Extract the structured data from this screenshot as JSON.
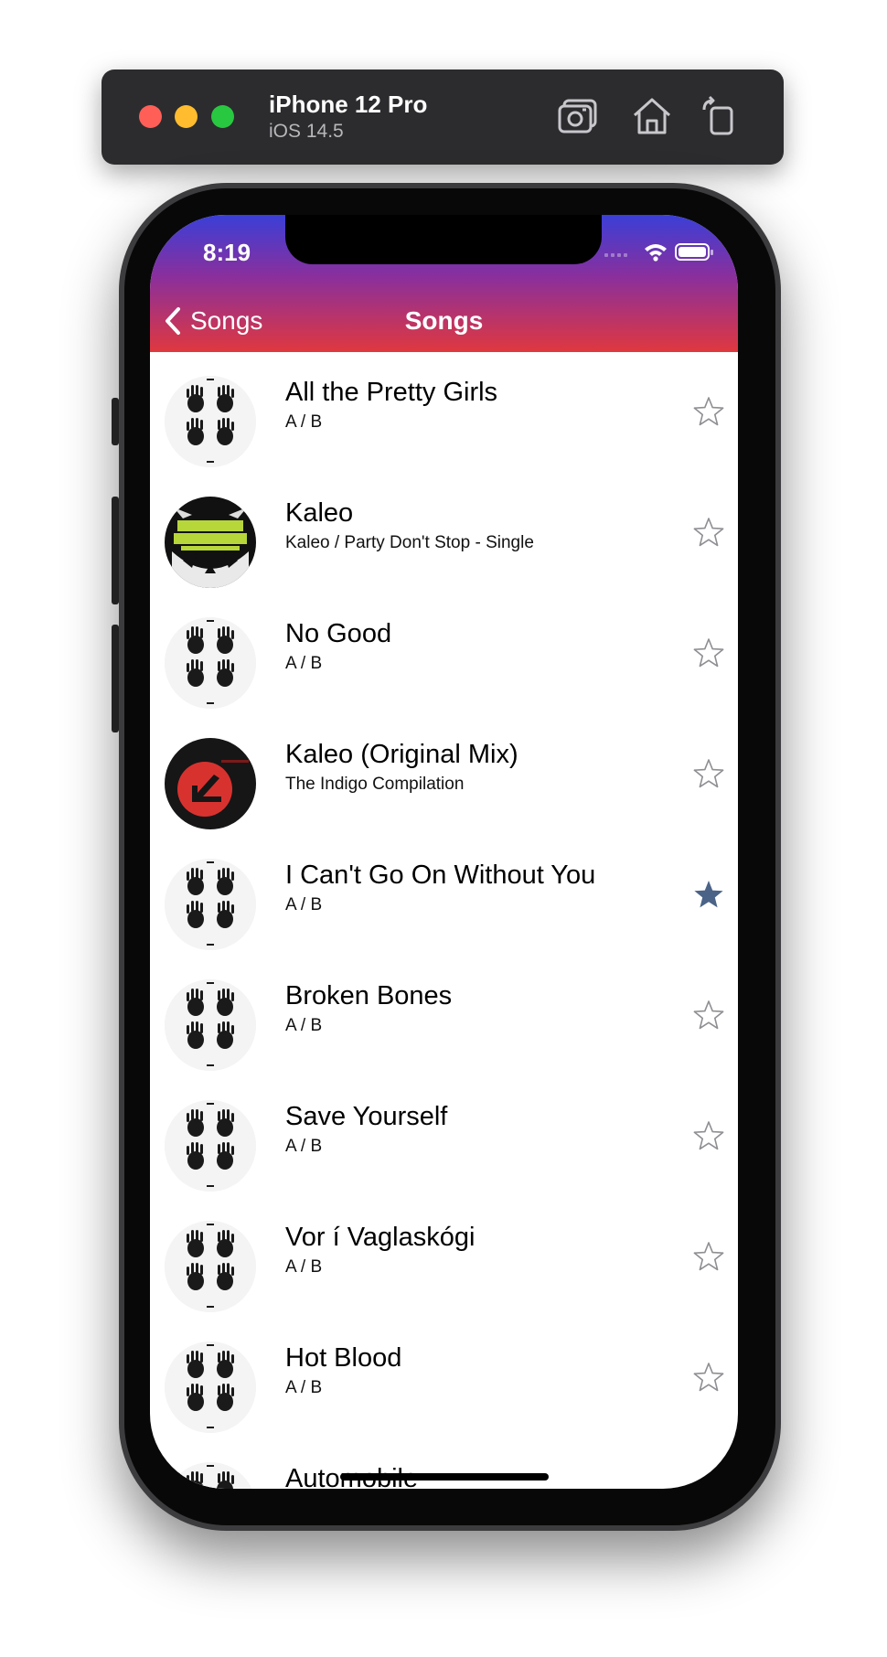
{
  "simulator": {
    "device": "iPhone 12 Pro",
    "os": "iOS 14.5",
    "controls": [
      "screenshot-icon",
      "home-icon",
      "rotate-icon"
    ]
  },
  "status_bar": {
    "time": "8:19"
  },
  "nav": {
    "back_label": "Songs",
    "title": "Songs"
  },
  "songs": [
    {
      "title": "All the Pretty Girls",
      "subtitle": "A / B",
      "art": "handprints",
      "favorite": false
    },
    {
      "title": "Kaleo",
      "subtitle": "Kaleo / Party Don't Stop - Single",
      "art": "tiger",
      "favorite": false
    },
    {
      "title": "No Good",
      "subtitle": "A / B",
      "art": "handprints",
      "favorite": false
    },
    {
      "title": "Kaleo (Original Mix)",
      "subtitle": "The Indigo Compilation",
      "art": "red-disc",
      "favorite": false
    },
    {
      "title": "I Can't Go On Without You",
      "subtitle": "A / B",
      "art": "handprints",
      "favorite": true
    },
    {
      "title": "Broken Bones",
      "subtitle": "A / B",
      "art": "handprints",
      "favorite": false
    },
    {
      "title": "Save Yourself",
      "subtitle": "A / B",
      "art": "handprints",
      "favorite": false
    },
    {
      "title": "Vor í Vaglaskógi",
      "subtitle": "A / B",
      "art": "handprints",
      "favorite": false
    },
    {
      "title": "Hot Blood",
      "subtitle": "A / B",
      "art": "handprints",
      "favorite": false
    },
    {
      "title": "Automobile",
      "subtitle": "",
      "art": "handprints",
      "favorite": false
    }
  ],
  "colors": {
    "header_top": "#3a3fd7",
    "header_bottom": "#e0383e",
    "star_filled": "#4a6387",
    "star_outline": "#8e8e93"
  }
}
